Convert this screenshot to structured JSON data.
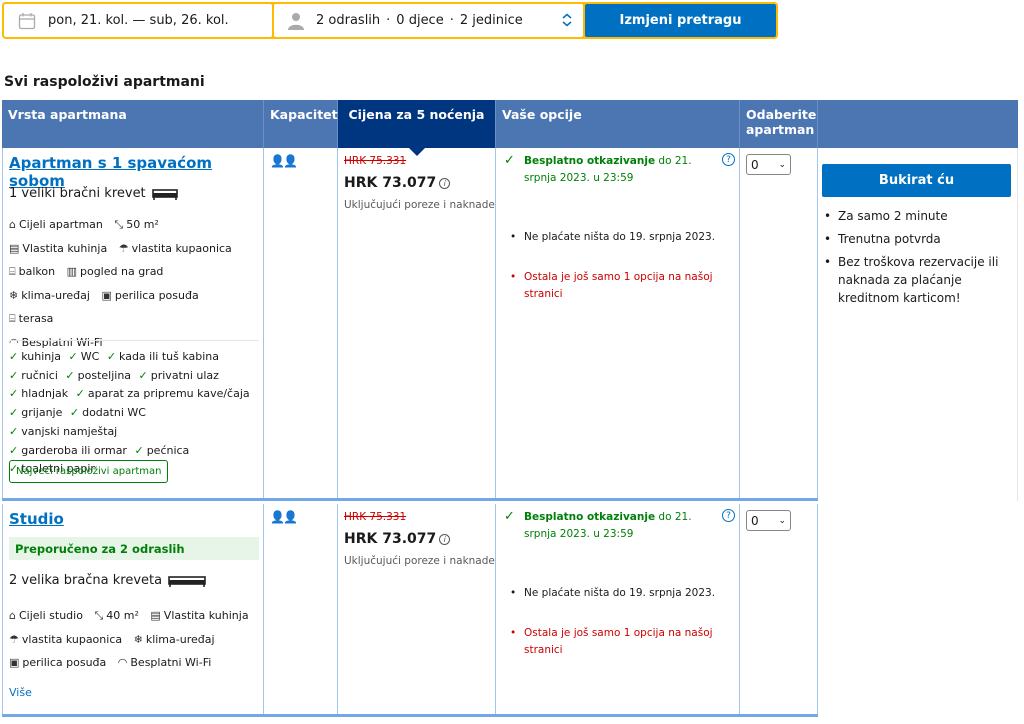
{
  "search": {
    "dates": "pon, 21. kol. — sub, 26. kol.",
    "guests": [
      "2 odraslih",
      "0 djece",
      "2 jedinice"
    ],
    "separator": "·",
    "button": "Izmjeni pretragu"
  },
  "section_title": "Svi raspoloživi apartmani",
  "headers": {
    "type": "Vrsta apartmana",
    "capacity": "Kapacitet",
    "price": "Cijena za 5 noćenja",
    "options": "Vaše opcije",
    "select": "Odaberite apartman"
  },
  "rooms": [
    {
      "name": "Apartman s 1 spavaćom sobom",
      "bed": "1 veliki bračni krevet",
      "facilities": [
        {
          "icon": "home-icon",
          "glyph": "⌂",
          "label": "Cijeli apartman"
        },
        {
          "icon": "size-icon",
          "glyph": "⤡",
          "label": "50 m²"
        },
        {
          "icon": "kitchen-icon",
          "glyph": "▤",
          "label": "Vlastita kuhinja"
        },
        {
          "icon": "bath-icon",
          "glyph": "☂",
          "label": "vlastita kupaonica"
        },
        {
          "icon": "balcony-icon",
          "glyph": "⌸",
          "label": "balkon"
        },
        {
          "icon": "city-icon",
          "glyph": "▥",
          "label": "pogled na grad"
        },
        {
          "icon": "snowflake-icon",
          "glyph": "❄",
          "label": "klima-uređaj"
        },
        {
          "icon": "dishwasher-icon",
          "glyph": "▣",
          "label": "perilica posuđa"
        },
        {
          "icon": "terrace-icon",
          "glyph": "⌸",
          "label": "terasa"
        },
        {
          "icon": "wifi-icon",
          "glyph": "◠",
          "label": "Besplatni Wi-Fi"
        }
      ],
      "amenities": [
        "kuhinja",
        "WC",
        "kada ili tuš kabina",
        "ručnici",
        "posteljina",
        "privatni ulaz",
        "hladnjak",
        "aparat za pripremu kave/čaja",
        "grijanje",
        "dodatni WC",
        "vanjski namještaj",
        "garderoba ili ormar",
        "pećnica",
        "toaletni papir"
      ],
      "badge": "Najveći raspoloživi apartman",
      "old_price": "HRK 75.331",
      "price": "HRK 73.077",
      "price_note": "Uključujući poreze i naknade",
      "cancel_bold": "Besplatno otkazivanje",
      "cancel_rest": "do 21. srpnja 2023. u 23:59",
      "pay_note": "Ne plaćate ništa do 19. srpnja 2023.",
      "scarcity": "Ostala je još samo 1 opcija na našoj stranici",
      "select_value": "0"
    },
    {
      "name": "Studio",
      "recommended": "Preporučeno za 2 odraslih",
      "bed": "2 velika bračna kreveta",
      "facilities": [
        {
          "icon": "home-icon",
          "glyph": "⌂",
          "label": "Cijeli studio"
        },
        {
          "icon": "size-icon",
          "glyph": "⤡",
          "label": "40 m²"
        },
        {
          "icon": "kitchen-icon",
          "glyph": "▤",
          "label": "Vlastita kuhinja"
        },
        {
          "icon": "bath-icon",
          "glyph": "☂",
          "label": "vlastita kupaonica"
        },
        {
          "icon": "snowflake-icon",
          "glyph": "❄",
          "label": "klima-uređaj"
        },
        {
          "icon": "dishwasher-icon",
          "glyph": "▣",
          "label": "perilica posuđa"
        },
        {
          "icon": "wifi-icon",
          "glyph": "◠",
          "label": "Besplatni Wi-Fi"
        }
      ],
      "more": "Više",
      "old_price": "HRK 75.331",
      "price": "HRK 73.077",
      "price_note": "Uključujući poreze i naknade",
      "cancel_bold": "Besplatno otkazivanje",
      "cancel_rest": "do 21. srpnja 2023. u 23:59",
      "pay_note": "Ne plaćate ništa do 19. srpnja 2023.",
      "scarcity": "Ostala je još samo 1 opcija na našoj stranici",
      "select_value": "0"
    }
  ],
  "booking": {
    "button": "Bukirat ću",
    "benefits": [
      "Za samo 2 minute",
      "Trenutna potvrda",
      "Bez troškova rezervacije ili naknada za plaćanje kreditnom karticom!"
    ]
  },
  "colors": {
    "accent": "#0071c2",
    "header": "#4c76b2",
    "header_active": "#003580",
    "search_border": "#febb02",
    "green": "#008009",
    "red": "#cc0000"
  }
}
